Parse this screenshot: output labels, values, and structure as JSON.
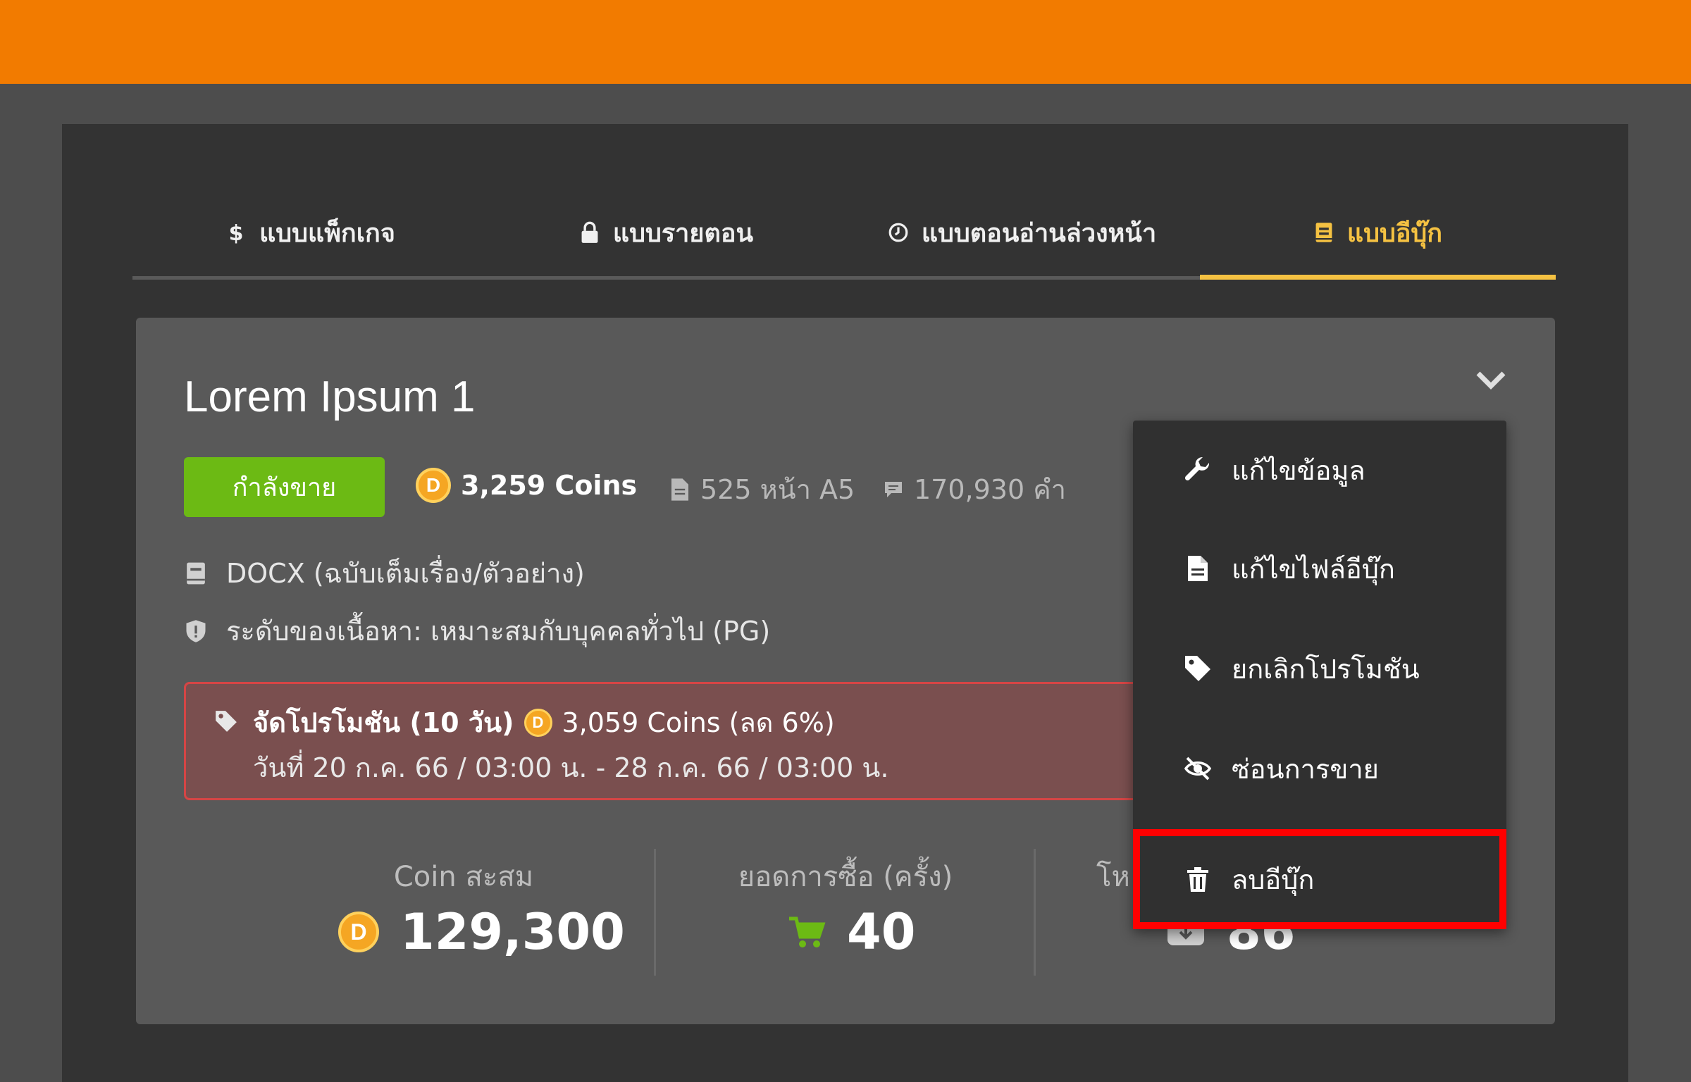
{
  "tabs": [
    {
      "label": "แบบแพ็กเกจ",
      "icon": "dollar-icon"
    },
    {
      "label": "แบบรายตอน",
      "icon": "lock-icon"
    },
    {
      "label": "แบบตอนอ่านล่วงหน้า",
      "icon": "clock-icon"
    },
    {
      "label": "แบบอีบุ๊ก",
      "icon": "book-icon",
      "active": true
    }
  ],
  "ebook": {
    "title": "Lorem Ipsum 1",
    "status": "กำลังขาย",
    "coins": "3,259 Coins",
    "pages": "525 หน้า A5",
    "words": "170,930 คำ",
    "format": "DOCX (ฉบับเต็มเรื่อง/ตัวอย่าง)",
    "rating": "ระดับของเนื้อหา: เหมาะสมกับบุคคลทั่วไป (PG)"
  },
  "promo": {
    "title": "จัดโปรโมชัน (10 วัน)",
    "price": "3,059 Coins (ลด 6%)",
    "dates": "วันที่ 20 ก.ค. 66 / 03:00 น. - 28 ก.ค. 66 / 03:00 น."
  },
  "stats": {
    "coin_label": "Coin สะสม",
    "coin_value": "129,300",
    "purchases_label": "ยอดการซื้อ (ครั้ง)",
    "purchases_value": "40",
    "downloads_label_partial": "โห",
    "downloads_value_partial": "86"
  },
  "coin_letter": "D",
  "menu": {
    "items": [
      {
        "label": "แก้ไขข้อมูล",
        "icon": "wrench-icon"
      },
      {
        "label": "แก้ไขไฟล์อีบุ๊ก",
        "icon": "file-icon"
      },
      {
        "label": "ยกเลิกโปรโมชัน",
        "icon": "tag-icon"
      },
      {
        "label": "ซ่อนการขาย",
        "icon": "eye-slash-icon"
      },
      {
        "label": "ลบอีบุ๊ก",
        "icon": "trash-icon",
        "highlighted": true
      }
    ]
  },
  "colors": {
    "topbar": "#f27b00",
    "accent": "#f5c242",
    "status_green": "#6cba14",
    "promo_border": "#d64545",
    "highlight": "#ff0000",
    "cart_green": "#6cba14"
  }
}
